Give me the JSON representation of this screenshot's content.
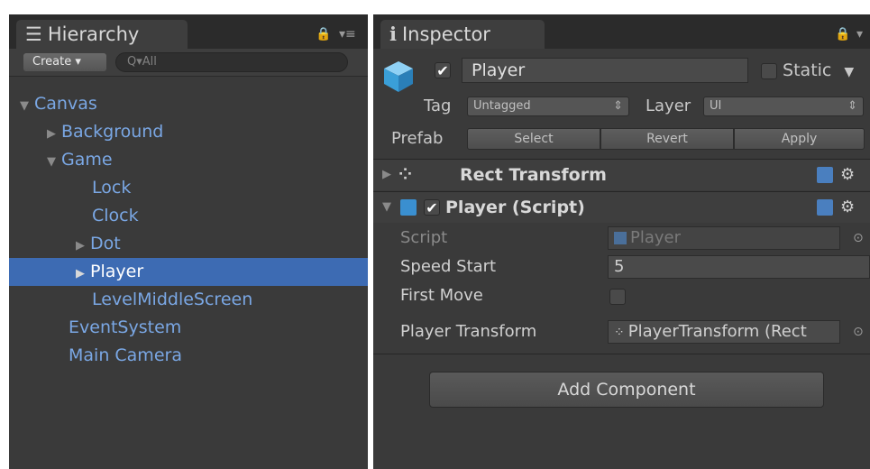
{
  "hierarchy": {
    "tab_label": "Hierarchy",
    "create_label": "Create ▾",
    "search_placeholder": "Q▾All",
    "items": [
      {
        "label": "Canvas",
        "arrow": "▼"
      },
      {
        "label": "Background",
        "arrow": "▶"
      },
      {
        "label": "Game",
        "arrow": "▼"
      },
      {
        "label": "Lock",
        "arrow": ""
      },
      {
        "label": "Clock",
        "arrow": ""
      },
      {
        "label": "Dot",
        "arrow": "▶"
      },
      {
        "label": "Player",
        "arrow": "▶"
      },
      {
        "label": "LevelMiddleScreen",
        "arrow": ""
      },
      {
        "label": "EventSystem",
        "arrow": ""
      },
      {
        "label": "Main Camera",
        "arrow": ""
      }
    ]
  },
  "inspector": {
    "tab_label": "Inspector",
    "object_name": "Player",
    "static_label": "Static",
    "tag_label": "Tag",
    "tag_value": "Untagged",
    "layer_label": "Layer",
    "layer_value": "UI",
    "prefab_label": "Prefab",
    "prefab_select": "Select",
    "prefab_revert": "Revert",
    "prefab_apply": "Apply",
    "rect_transform_title": "Rect Transform",
    "script_component_title": "Player (Script)",
    "script_label": "Script",
    "script_value": "Player",
    "speed_label": "Speed Start",
    "speed_value": "5",
    "first_move_label": "First Move",
    "player_transform_label": "Player Transform",
    "player_transform_value": "PlayerTransform (Rect",
    "add_component_label": "Add Component"
  },
  "colors": {
    "panel_bg": "#3a3a3a",
    "selection": "#3d6bb3",
    "item_text": "#7aa7e4"
  }
}
